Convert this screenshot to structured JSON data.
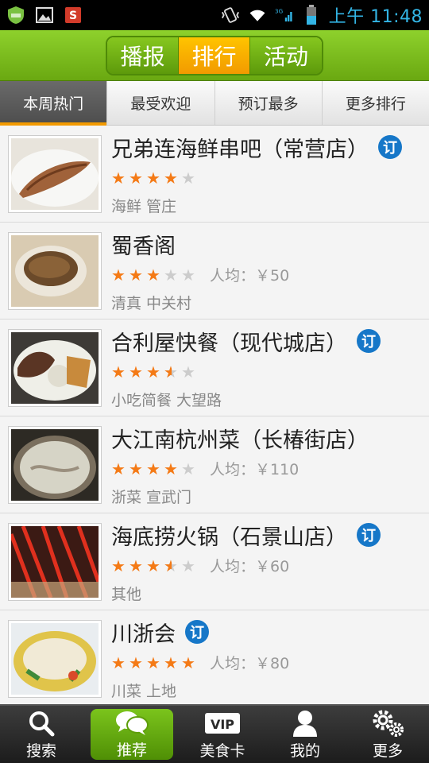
{
  "status": {
    "time": "上午 11:48",
    "network": "3G"
  },
  "header": {
    "tabs": [
      {
        "label": "播报"
      },
      {
        "label": "排行"
      },
      {
        "label": "活动"
      }
    ],
    "active_tab": 1
  },
  "subtabs": [
    {
      "label": "本周热门"
    },
    {
      "label": "最受欢迎"
    },
    {
      "label": "预订最多"
    },
    {
      "label": "更多排行"
    }
  ],
  "order_badge": "订",
  "restaurants": [
    {
      "name": "兄弟连海鲜串吧（常营店）",
      "rating": 4,
      "avg_price": "",
      "tags": "海鲜 管庄",
      "bookable": true
    },
    {
      "name": "蜀香阁",
      "rating": 3,
      "avg_price": "人均：￥50",
      "tags": "清真 中关村",
      "bookable": false
    },
    {
      "name": "合利屋快餐（现代城店）",
      "rating": 3.5,
      "avg_price": "",
      "tags": "小吃简餐 大望路",
      "bookable": true
    },
    {
      "name": "大江南杭州菜（长椿街店）",
      "rating": 4,
      "avg_price": "人均：￥110",
      "tags": "浙菜 宣武门",
      "bookable": false
    },
    {
      "name": "海底捞火锅（石景山店）",
      "rating": 3.5,
      "avg_price": "人均：￥60",
      "tags": "其他",
      "bookable": true
    },
    {
      "name": "川浙会",
      "rating": 5,
      "avg_price": "人均：￥80",
      "tags": "川菜 上地",
      "bookable": true
    }
  ],
  "bottom_nav": [
    {
      "label": "搜索",
      "icon": "search-icon"
    },
    {
      "label": "推荐",
      "icon": "chat-icon"
    },
    {
      "label": "美食卡",
      "icon": "vip-card-icon",
      "badge": "VIP"
    },
    {
      "label": "我的",
      "icon": "user-icon"
    },
    {
      "label": "更多",
      "icon": "gears-icon"
    }
  ],
  "bottom_active": 1
}
